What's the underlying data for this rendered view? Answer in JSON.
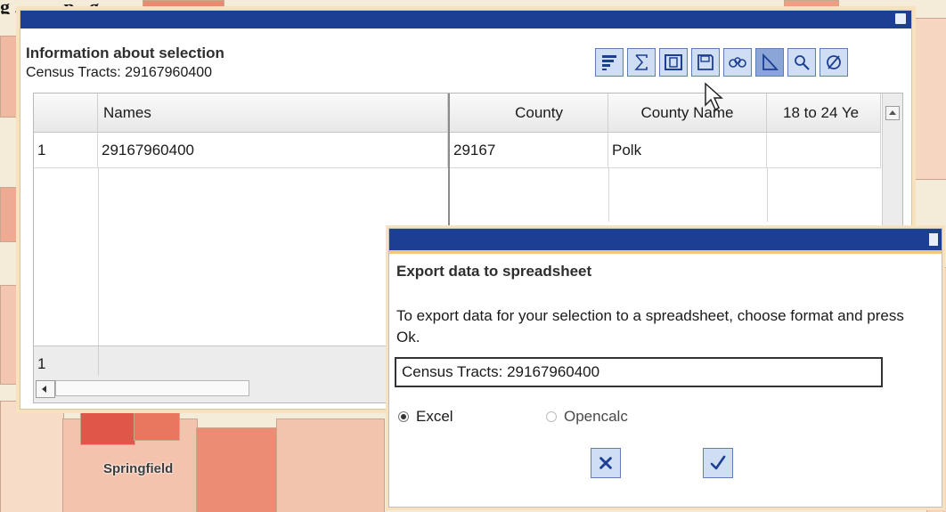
{
  "colors": {
    "titlebar": "#1d3f93",
    "accent_border": "#f4c57e",
    "tool_bg": "#cfdef3",
    "map_red": "#e86a54"
  },
  "map": {
    "city_label": "Springfield"
  },
  "panel": {
    "title": "Information about selection",
    "subtitle": "Census Tracts: 29167960400",
    "toolbar_icons": [
      "sort-icon",
      "sum-icon",
      "columns-icon",
      "save-icon",
      "binoculars-icon",
      "select-shape-icon",
      "zoom-icon",
      "clear-icon"
    ],
    "grid": {
      "frozen_headers": [
        "",
        "Names"
      ],
      "columns": [
        "County",
        "County Name",
        "18 to 24 Ye"
      ],
      "rows": [
        {
          "num": "1",
          "name": "29167960400",
          "county": "29167",
          "county_name": "Polk",
          "age_18_24": ""
        }
      ],
      "footer_count": "1"
    }
  },
  "dialog": {
    "title": "Export data to spreadsheet",
    "text": "To export data for your selection to a spreadsheet, choose format and press Ok.",
    "input_value": "Census Tracts: 29167960400",
    "format_options": [
      {
        "label": "Excel",
        "selected": true
      },
      {
        "label": "Opencalc",
        "selected": false
      }
    ],
    "cancel_icon": "close-icon",
    "ok_icon": "check-icon"
  }
}
